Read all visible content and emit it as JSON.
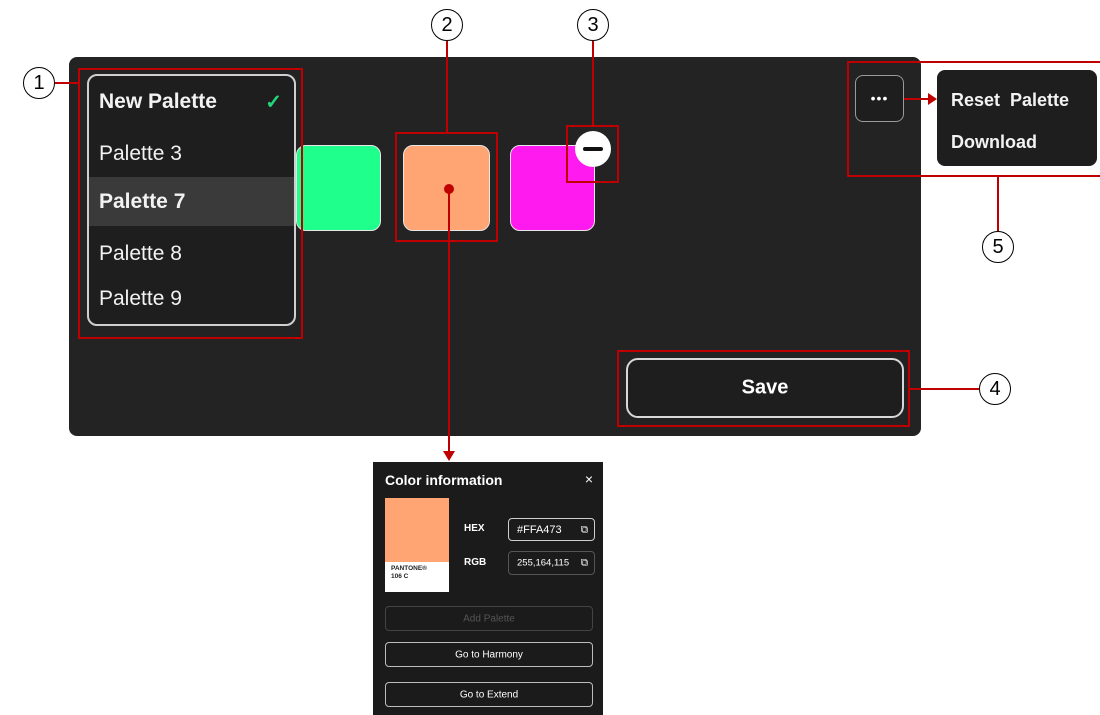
{
  "palette_dropdown": {
    "items": [
      {
        "label": "New Palette",
        "state": "selected"
      },
      {
        "label": "Palette 3",
        "state": "normal"
      },
      {
        "label": "Palette 7",
        "state": "hover"
      },
      {
        "label": "Palette 8",
        "state": "normal"
      },
      {
        "label": "Palette 9",
        "state": "normal"
      }
    ],
    "check_icon": "✓"
  },
  "swatches": [
    {
      "color": "#1EFF8C"
    },
    {
      "color": "#FFA473"
    },
    {
      "color": "#FF1AF0"
    }
  ],
  "remove_icon": "minus-circle-icon",
  "more_button_icon": "•••",
  "more_menu": {
    "items": [
      "Reset  Palette",
      "Download"
    ]
  },
  "save_label": "Save",
  "annotations": [
    "1",
    "2",
    "3",
    "4",
    "5"
  ],
  "color_info": {
    "title": "Color information",
    "close_icon": "×",
    "swatch_color": "#FFA473",
    "pantone_line1": "PANTONE®",
    "pantone_line2": "106 C",
    "hex_label": "HEX",
    "hex_value": "#FFA473",
    "rgb_label": "RGB",
    "rgb_value": "255,164,115",
    "copy_icon": "⧉",
    "add_palette": "Add Palette",
    "go_harmony": "Go to Harmony",
    "go_extend": "Go to Extend"
  },
  "colors": {
    "panel_bg": "#232323",
    "annotation_red": "#C00000",
    "check_green": "#22D67A"
  }
}
